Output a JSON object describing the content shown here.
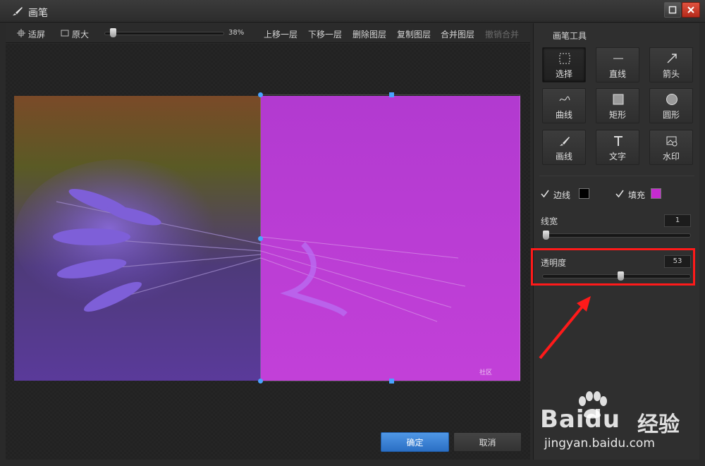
{
  "window": {
    "title": "画笔"
  },
  "toolbar": {
    "fit_screen": "适屏",
    "original_size": "原大",
    "zoom_value": 38,
    "zoom_label": "38%",
    "move_up": "上移一层",
    "move_down": "下移一层",
    "delete_layer": "删除图层",
    "copy_layer": "复制图层",
    "merge_layers": "合并图层",
    "undo_merge": "撤销合并"
  },
  "canvas": {
    "watermark": "社区"
  },
  "buttons": {
    "ok": "确定",
    "cancel": "取消"
  },
  "panel": {
    "title": "画笔工具",
    "tools": [
      {
        "label": "选择",
        "icon": "select-icon"
      },
      {
        "label": "直线",
        "icon": "line-icon"
      },
      {
        "label": "箭头",
        "icon": "arrow-icon"
      },
      {
        "label": "曲线",
        "icon": "curve-icon"
      },
      {
        "label": "矩形",
        "icon": "rectangle-icon"
      },
      {
        "label": "圆形",
        "icon": "circle-icon"
      },
      {
        "label": "画线",
        "icon": "brush-icon"
      },
      {
        "label": "文字",
        "icon": "text-icon"
      },
      {
        "label": "水印",
        "icon": "watermark-icon"
      }
    ],
    "stroke": {
      "label": "边线",
      "checked": true,
      "color": "#000000"
    },
    "fill": {
      "label": "填充",
      "checked": true,
      "color": "#c62bd0"
    },
    "line_width": {
      "label": "线宽",
      "value": "1"
    },
    "opacity": {
      "label": "透明度",
      "value": "53"
    }
  },
  "overlay": {
    "baidu_logo": "Bai",
    "baidu_logo_suffix": "du",
    "baidu_cn": "经验",
    "baidu_url": "jingyan.baidu.com"
  },
  "colors": {
    "accent": "#2b6fc4",
    "highlight": "#ff1a1a",
    "handle": "#4aa3ff"
  }
}
